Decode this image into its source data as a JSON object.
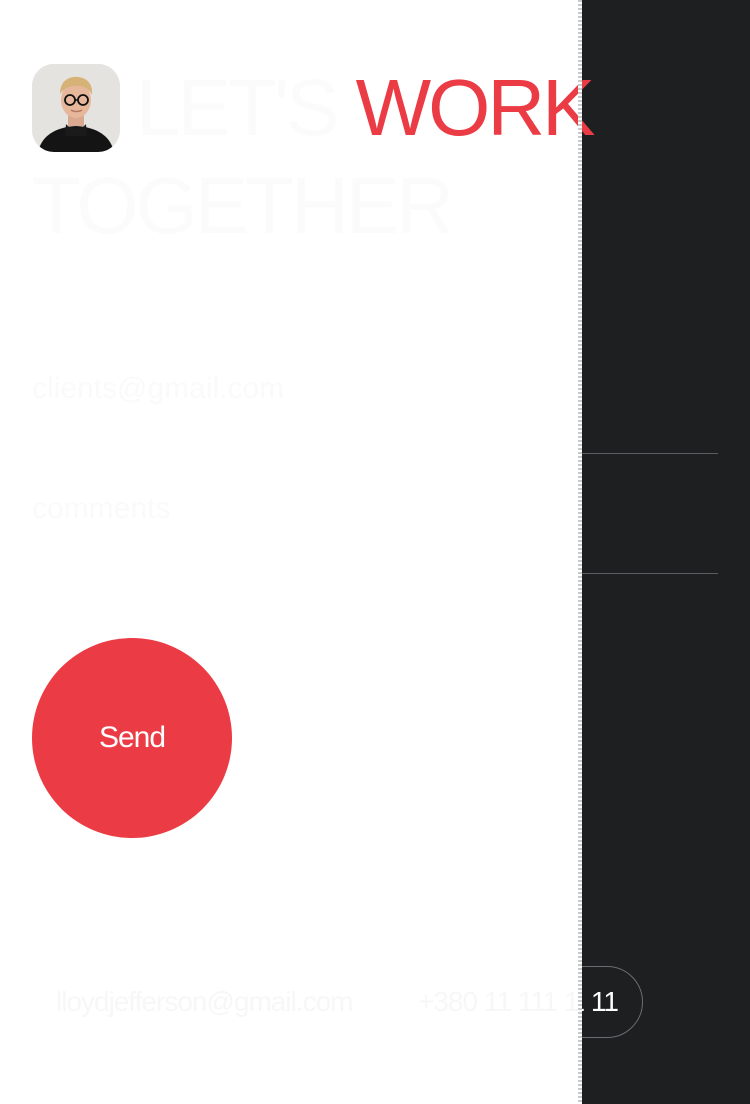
{
  "header": {
    "avatar_alt": "Portrait of Lloyd Jefferson",
    "headline_word1": "LET'S",
    "headline_word2": "WORK",
    "headline_word3": "TOGETHER"
  },
  "form": {
    "email_placeholder": "clients@gmail.com",
    "comments_placeholder": "comments",
    "send_label": "Send"
  },
  "contacts": {
    "email": "lloydjefferson@gmail.com",
    "phone": "+380 11 111 11 11"
  },
  "colors": {
    "accent": "#eb3b45",
    "dark_background": "#1e1f21",
    "white_panel": "#ffffff"
  },
  "icons": {
    "avatar": "person-photo"
  }
}
